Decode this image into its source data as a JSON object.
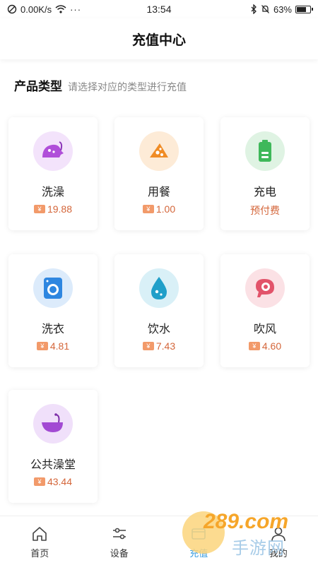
{
  "status_bar": {
    "speed": "0.00K/s",
    "time": "13:54",
    "battery": "63%",
    "battery_level": 0.63
  },
  "nav": {
    "title": "充值中心"
  },
  "section": {
    "title": "产品类型",
    "hint": "请选择对应的类型进行充值"
  },
  "products": [
    {
      "name": "洗澡",
      "price": "19.88",
      "icon": "shower-icon",
      "color": "#b04fd9"
    },
    {
      "name": "用餐",
      "price": "1.00",
      "icon": "meal-icon",
      "color": "#f08c25"
    },
    {
      "name": "充电",
      "price": "预付费",
      "icon": "battery-charge-icon",
      "color": "#3fb85a"
    },
    {
      "name": "洗衣",
      "price": "4.81",
      "icon": "washing-machine-icon",
      "color": "#2e86e0"
    },
    {
      "name": "饮水",
      "price": "7.43",
      "icon": "water-drop-icon",
      "color": "#1f9fc9"
    },
    {
      "name": "吹风",
      "price": "4.60",
      "icon": "hair-dryer-icon",
      "color": "#e2536a"
    },
    {
      "name": "公共澡堂",
      "price": "43.44",
      "icon": "public-bath-icon",
      "color": "#a24ad3"
    }
  ],
  "yen_symbol": "¥",
  "tabs": [
    {
      "label": "首页",
      "icon": "home-icon"
    },
    {
      "label": "设备",
      "icon": "sliders-icon"
    },
    {
      "label": "充值",
      "icon": "recharge-icon"
    },
    {
      "label": "我的",
      "icon": "user-icon"
    }
  ],
  "watermark": {
    "number": "289.com",
    "text": "手游网"
  }
}
